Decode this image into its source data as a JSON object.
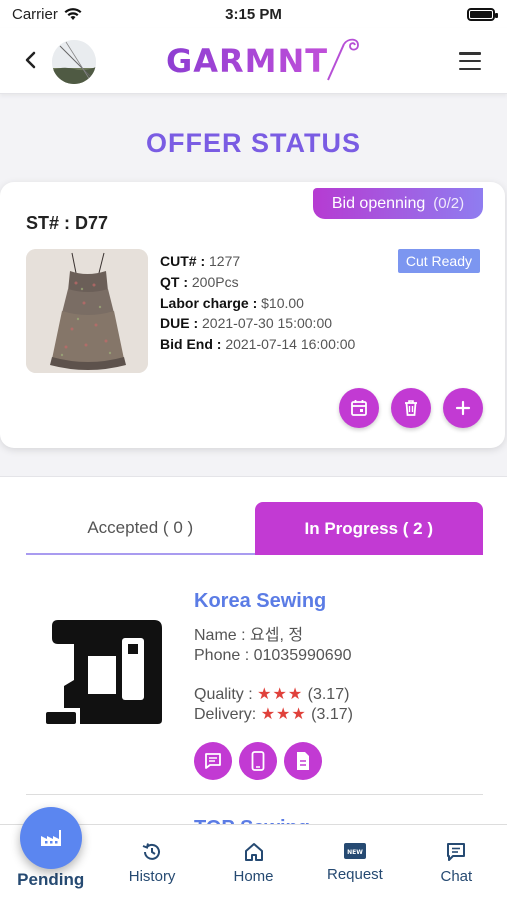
{
  "status_bar": {
    "carrier": "Carrier",
    "time": "3:15 PM"
  },
  "header": {
    "logo": "GARMNT"
  },
  "page_title": "OFFER STATUS",
  "offer": {
    "bid_status": "Bid openning",
    "bid_count": "(0/2)",
    "style_no": "ST# : D77",
    "cut_label": "CUT# :",
    "cut_value": "1277",
    "qt_label": "QT :",
    "qt_value": "200Pcs",
    "labor_label": "Labor charge :",
    "labor_value": "$10.00",
    "due_label": "DUE :",
    "due_value": "2021-07-30 15:00:00",
    "bid_end_label": "Bid End :",
    "bid_end_value": "2021-07-14 16:00:00",
    "cut_ready": "Cut Ready"
  },
  "tabs": [
    {
      "label": "Accepted ( 0 )"
    },
    {
      "label": "In Progress ( 2 )"
    }
  ],
  "vendor": {
    "name": "Korea Sewing",
    "contact_name": "Name : 요셉, 정",
    "phone": "Phone : 01035990690",
    "quality_label": "Quality :",
    "quality_stars": "★★★",
    "quality_score": "(3.17)",
    "delivery_label": "Delivery:",
    "delivery_stars": "★★★",
    "delivery_score": "(3.17)"
  },
  "next_vendor": {
    "name": "TOP Sewing"
  },
  "nav": [
    {
      "label": "Pending",
      "icon": "factory-icon"
    },
    {
      "label": "History",
      "icon": "history-icon"
    },
    {
      "label": "Home",
      "icon": "home-icon"
    },
    {
      "label": "Request",
      "icon": "new-badge-icon"
    },
    {
      "label": "Chat",
      "icon": "chat-icon"
    }
  ],
  "colors": {
    "accent": "#c23ad3",
    "title": "#7a5ce3",
    "link": "#5b7ce5",
    "fab": "#5b86f0",
    "cut_ready": "#7c96f0",
    "stars": "#e0413b"
  }
}
